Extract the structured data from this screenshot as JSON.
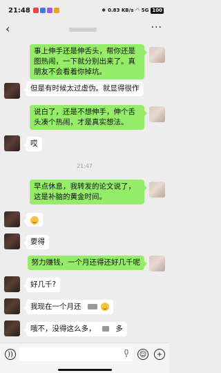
{
  "status": {
    "time": "21:48",
    "net_speed": "0.83",
    "net_unit": "KB/s",
    "signal": "5G",
    "battery": "100"
  },
  "nav": {
    "back_icon": "chevron-left-icon",
    "more": "···"
  },
  "messages": [
    {
      "side": "right",
      "text": "事上伸手还是伸舌头，帮你还是图热闹，一下就分别出来了。真朋友不会看着你掉坑。"
    },
    {
      "side": "left",
      "text": "但是有时候太过虚伪。就显得很作"
    },
    {
      "side": "right",
      "text": "说白了，还是不想伸手，伸个舌头凑个热闹，才是真实想法。"
    },
    {
      "side": "left",
      "text": "哎"
    },
    {
      "side": "time",
      "text": "21:47"
    },
    {
      "side": "right",
      "text": "早点休息，我转发的论文说了，这是补脑的黄金时间。"
    },
    {
      "side": "left",
      "text": ""
    },
    {
      "side": "left",
      "text": "要得"
    },
    {
      "side": "right",
      "text": "努力赚钱，一个月还得还好几千呢"
    },
    {
      "side": "left",
      "text": "好几千?"
    },
    {
      "side": "left",
      "text": "我现在一个月还"
    },
    {
      "side": "left",
      "text": "哦不，没得这么多，",
      "suffix": "多"
    }
  ]
}
